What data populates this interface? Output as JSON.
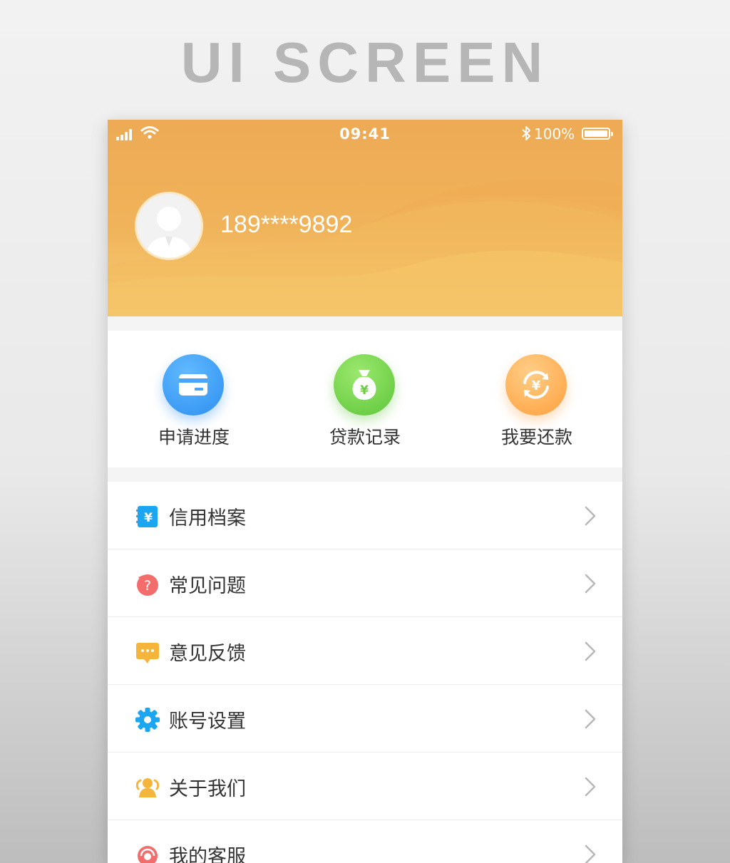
{
  "banner": {
    "title": "UI SCREEN"
  },
  "status_bar": {
    "time": "09:41",
    "battery": "100%"
  },
  "profile": {
    "phone": "189****9892"
  },
  "quick_actions": [
    {
      "label": "申请进度",
      "icon": "card-icon",
      "color": "#3b9bf5"
    },
    {
      "label": "贷款记录",
      "icon": "money-bag-icon",
      "color": "#6fd14a"
    },
    {
      "label": "我要还款",
      "icon": "repay-icon",
      "color": "#ffa94a"
    }
  ],
  "menu": [
    {
      "label": "信用档案",
      "icon": "credit-file-icon",
      "color": "#1aa6f0"
    },
    {
      "label": "常见问题",
      "icon": "question-icon",
      "color": "#f46d6d"
    },
    {
      "label": "意见反馈",
      "icon": "feedback-icon",
      "color": "#f5b53a"
    },
    {
      "label": "账号设置",
      "icon": "gear-icon",
      "color": "#1aa6f0"
    },
    {
      "label": "关于我们",
      "icon": "team-icon",
      "color": "#f5b53a"
    },
    {
      "label": "我的客服",
      "icon": "customer-service-icon",
      "color": "#f46d6d"
    }
  ],
  "colors": {
    "header_top": "#eeaa55",
    "header_bottom": "#f7d077"
  }
}
